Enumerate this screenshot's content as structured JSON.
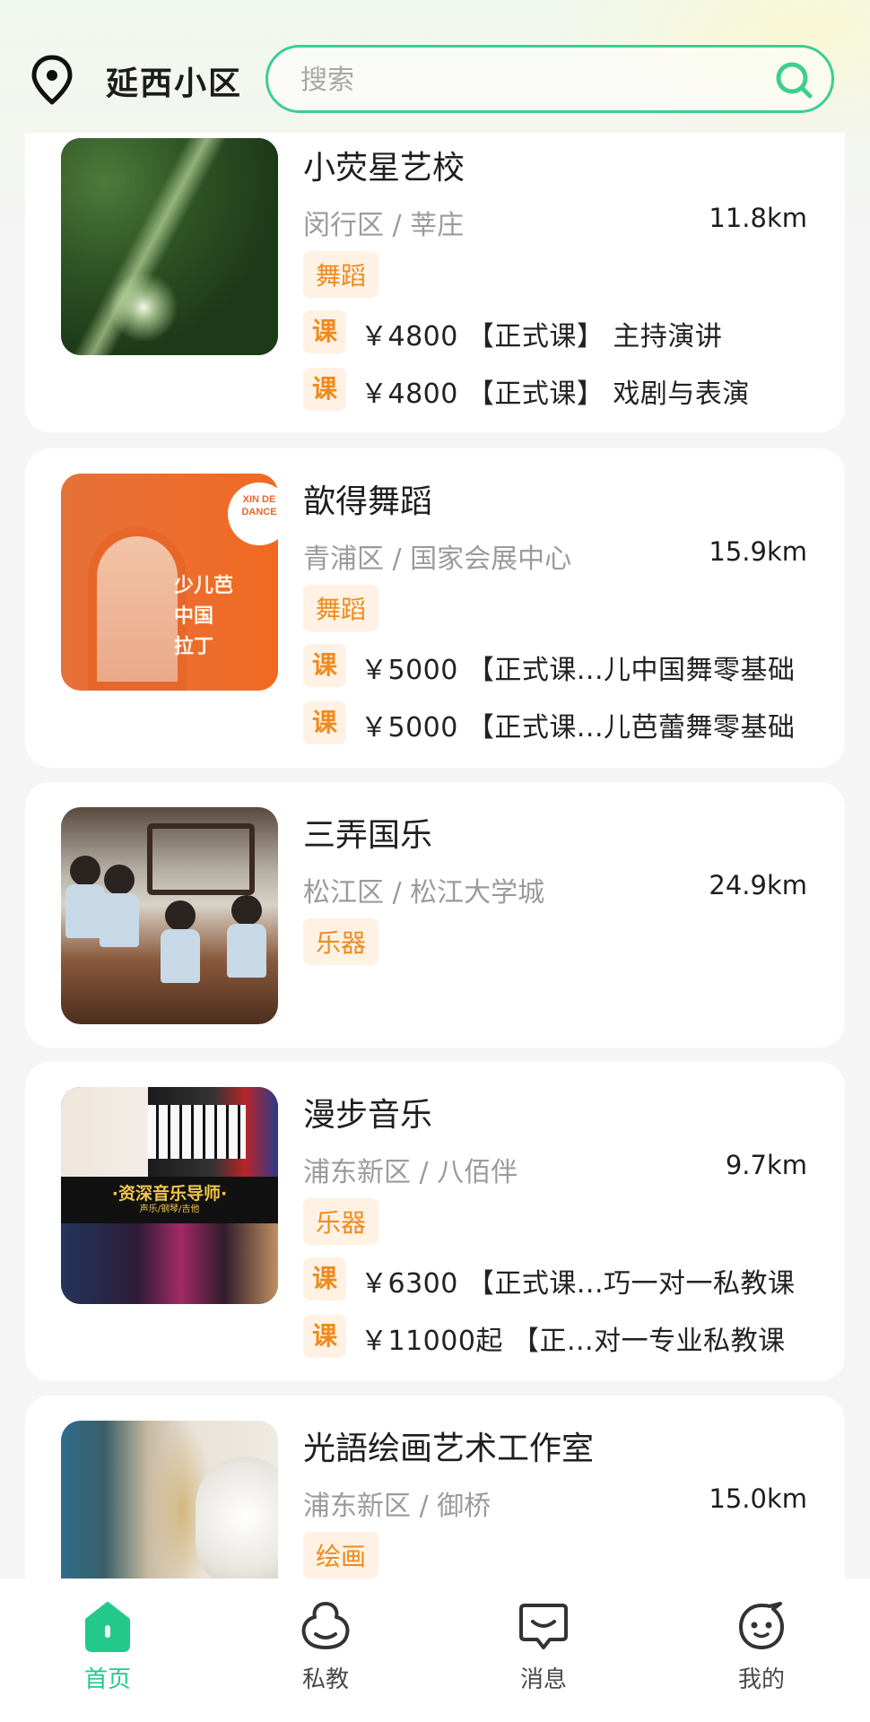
{
  "header": {
    "location": "延西小区",
    "search_placeholder": "搜索"
  },
  "colors": {
    "accent": "#3ccf8f",
    "tag_bg": "#fff1e3",
    "tag_text": "#f08a1c"
  },
  "items": [
    {
      "name": "小荧星艺校",
      "area": "闵行区 / 莘庄",
      "distance": "11.8km",
      "category": "舞蹈",
      "courses": [
        {
          "badge": "课",
          "text": "￥4800 【正式课】 主持演讲"
        },
        {
          "badge": "课",
          "text": "￥4800 【正式课】 戏剧与表演"
        }
      ]
    },
    {
      "name": "歆得舞蹈",
      "area": "青浦区 / 国家会展中心",
      "distance": "15.9km",
      "category": "舞蹈",
      "image_text": {
        "logo": "XIN DE DANCE",
        "promo_lines": [
          "少儿芭",
          "中国",
          "拉丁"
        ]
      },
      "courses": [
        {
          "badge": "课",
          "text": "￥5000 【正式课...儿中国舞零基础"
        },
        {
          "badge": "课",
          "text": "￥5000 【正式课...儿芭蕾舞零基础"
        }
      ]
    },
    {
      "name": "三弄国乐",
      "area": "松江区 / 松江大学城",
      "distance": "24.9km",
      "category": "乐器",
      "courses": []
    },
    {
      "name": "漫步音乐",
      "area": "浦东新区 / 八佰伴",
      "distance": "9.7km",
      "category": "乐器",
      "image_text": {
        "banner": "·资深音乐导师·",
        "banner_sub": "声乐/钢琴/吉他"
      },
      "courses": [
        {
          "badge": "课",
          "text": "￥6300 【正式课...巧一对一私教课"
        },
        {
          "badge": "课",
          "text": "￥11000起 【正...对一专业私教课"
        }
      ]
    },
    {
      "name": "光語绘画艺术工作室",
      "area": "浦东新区 / 御桥",
      "distance": "15.0km",
      "category": "绘画",
      "courses": []
    }
  ],
  "tabbar": [
    {
      "label": "首页",
      "icon": "home-icon",
      "active": true
    },
    {
      "label": "私教",
      "icon": "private-tutor-icon",
      "active": false
    },
    {
      "label": "消息",
      "icon": "message-icon",
      "active": false
    },
    {
      "label": "我的",
      "icon": "profile-icon",
      "active": false
    }
  ]
}
